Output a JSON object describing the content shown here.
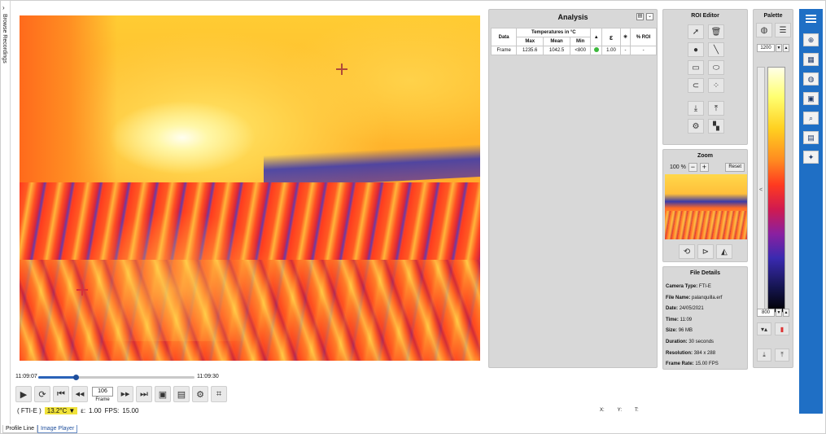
{
  "sidebar": {
    "collapse_glyph": "›",
    "label": "Browse Recordings"
  },
  "timeline": {
    "start": "11:09:07",
    "end": "11:09:30",
    "progress": 0.24
  },
  "player": {
    "buttons": [
      {
        "name": "play-button",
        "icon": "▶"
      },
      {
        "name": "loop-button",
        "icon": "⟳"
      },
      {
        "name": "first-frame-button",
        "icon": "⏮"
      },
      {
        "name": "rewind-button",
        "icon": "◀◀"
      }
    ],
    "buttons_after": [
      {
        "name": "fast-forward-button",
        "icon": "▶▶"
      },
      {
        "name": "last-frame-button",
        "icon": "⏭"
      },
      {
        "name": "snapshot-button",
        "icon": "▣"
      },
      {
        "name": "export-button",
        "icon": "▤"
      },
      {
        "name": "settings-button",
        "icon": "⚙"
      },
      {
        "name": "crop-button",
        "icon": "⌗"
      }
    ],
    "frame_value": "106",
    "frame_label": "Frame"
  },
  "status": {
    "camera": "( FTI-E )",
    "temp": "13.2°C",
    "emissivity_label": "ε:",
    "emissivity": "1.00",
    "fps_label": "FPS:",
    "fps": "15.00"
  },
  "coords": {
    "x": "X:",
    "y": "Y:",
    "t": "T:"
  },
  "tabs": [
    {
      "label": "Profile Line"
    },
    {
      "label": "Image Player"
    }
  ],
  "analysis": {
    "title": "Analysis",
    "col_data": "Data",
    "col_group": "Temperatures in °C",
    "col_max": "Max",
    "col_mean": "Mean",
    "col_min": "Min",
    "col_alarm": "▲",
    "col_eps": "ε",
    "col_ambient": "✳",
    "col_roi": "% ROI",
    "row": {
      "data": "Frame",
      "max": "1235.6",
      "mean": "1042.5",
      "min": "<800",
      "eps": "1.00",
      "ambient": "-",
      "roi": "-"
    }
  },
  "roi_editor": {
    "title": "ROI Editor",
    "tools": [
      {
        "name": "select-tool-icon",
        "icon": "➚"
      },
      {
        "name": "delete-icon",
        "icon": "🗑"
      },
      {
        "name": "point-tool-icon",
        "icon": "●"
      },
      {
        "name": "line-tool-icon",
        "icon": "╲"
      },
      {
        "name": "rectangle-tool-icon",
        "icon": "▭"
      },
      {
        "name": "ellipse-tool-icon",
        "icon": "⬭"
      },
      {
        "name": "freehand-tool-icon",
        "icon": "⊂"
      },
      {
        "name": "scatter-tool-icon",
        "icon": "⁘"
      },
      {
        "name": "import-roi-icon",
        "icon": "⤓"
      },
      {
        "name": "export-roi-icon",
        "icon": "⤒"
      },
      {
        "name": "roi-settings-icon",
        "icon": "⚙"
      },
      {
        "name": "roi-grid-icon",
        "icon": "▚"
      }
    ]
  },
  "zoom": {
    "title": "Zoom",
    "level": "100 %",
    "minus": "−",
    "plus": "+",
    "reset": "Reset"
  },
  "file_details": {
    "title": "File Details",
    "camera_type_label": "Camera Type:",
    "camera_type": "FTI-E",
    "file_name_label": "File Name:",
    "file_name": "palanquilla.erf",
    "date_label": "Date:",
    "date": "24/05/2021",
    "time_label": "Time:",
    "time": "11:09",
    "size_label": "Size:",
    "size": "96 MB",
    "duration_label": "Duration:",
    "duration": "30 seconds",
    "resolution_label": "Resolution:",
    "resolution": "384 x 288",
    "frame_rate_label": "Frame Rate:",
    "frame_rate": "15.00 FPS"
  },
  "palette": {
    "title": "Palette",
    "max": "1200",
    "min": "800",
    "side_arrow": "<"
  },
  "colors": {
    "toolbar_blue": "#1f6fc5",
    "panel_gray": "#d8d8d8",
    "temp_badge": "#f0e23a"
  }
}
